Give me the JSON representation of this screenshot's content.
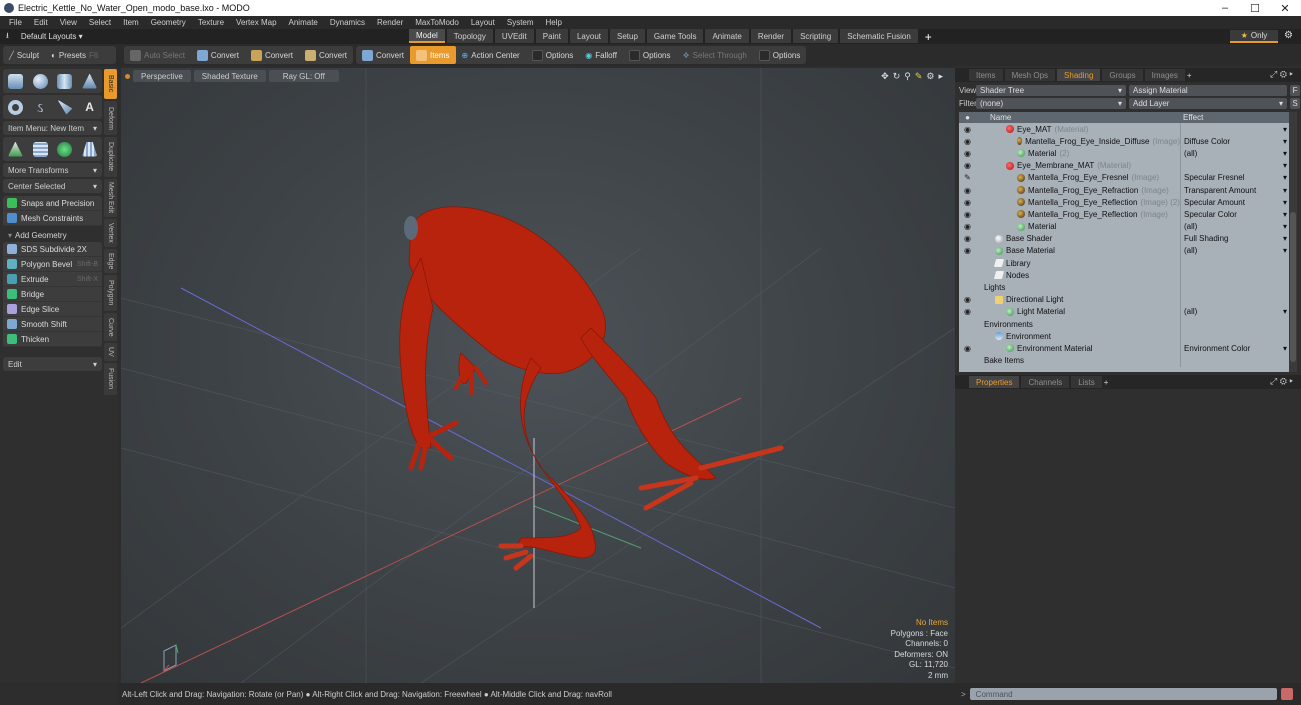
{
  "window": {
    "title": "Electric_Kettle_No_Water_Open_modo_base.lxo - MODO",
    "controls": {
      "minimize": "–",
      "maximize": "☐",
      "close": "✕"
    }
  },
  "menu": [
    "File",
    "Edit",
    "View",
    "Select",
    "Item",
    "Geometry",
    "Texture",
    "Vertex Map",
    "Animate",
    "Dynamics",
    "Render",
    "MaxToModo",
    "Layout",
    "System",
    "Help"
  ],
  "layoutbar": {
    "layouts_label": "Default Layouts ▾",
    "tabs": [
      "Model",
      "Topology",
      "UVEdit",
      "Paint",
      "Layout",
      "Setup",
      "Game Tools",
      "Animate",
      "Render",
      "Scripting",
      "Schematic Fusion"
    ],
    "active_tab": "Model",
    "add_tab": "+",
    "only_label": "Only"
  },
  "toolbar": {
    "sculpt": "Sculpt",
    "presets": "Presets",
    "presets_key": "F6",
    "auto_select": "Auto Select",
    "convert1": "Convert",
    "convert2": "Convert",
    "convert3": "Convert",
    "convert4": "Convert",
    "items": "Items",
    "action_center": "Action Center",
    "options1": "Options",
    "falloff": "Falloff",
    "options2": "Options",
    "select_through": "Select Through",
    "options3": "Options"
  },
  "leftpanel": {
    "item_menu": "Item Menu: New Item",
    "more_transforms": "More Transforms",
    "center_selected": "Center Selected",
    "snaps": "Snaps and Precision",
    "mesh_constraints": "Mesh Constraints",
    "add_geometry": "Add Geometry",
    "tools": [
      {
        "label": "SDS Subdivide 2X",
        "shortcut": ""
      },
      {
        "label": "Polygon Bevel",
        "shortcut": "Shift-B"
      },
      {
        "label": "Extrude",
        "shortcut": "Shift-X"
      },
      {
        "label": "Bridge",
        "shortcut": ""
      },
      {
        "label": "Edge Slice",
        "shortcut": ""
      },
      {
        "label": "Smooth Shift",
        "shortcut": ""
      },
      {
        "label": "Thicken",
        "shortcut": ""
      }
    ],
    "edit_dropdown": "Edit",
    "vtabs": [
      "Basic",
      "Deform",
      "Duplicate",
      "Mesh Edit",
      "Vertex",
      "Edge",
      "Polygon",
      "Curve",
      "UV",
      "Fusion"
    ],
    "active_vtab": "Basic"
  },
  "viewport": {
    "view": "Perspective",
    "shading": "Shaded Texture",
    "raygl": "Ray GL: Off",
    "info": {
      "selection": "No Items",
      "polygons": "Polygons : Face",
      "channels": "Channels: 0",
      "deformers": "Deformers: ON",
      "gl": "GL: 11,720",
      "unit": "2 mm"
    }
  },
  "statusbar": {
    "hint": "Alt-Left Click and Drag: Navigation: Rotate (or Pan) ● Alt-Right Click and Drag: Navigation: Freewheel ● Alt-Middle Click and Drag: navRoll"
  },
  "rightpanel": {
    "tabs": [
      "Items",
      "Mesh Ops",
      "Shading",
      "Groups",
      "Images"
    ],
    "active_tab": "Shading",
    "view_label": "View",
    "view_value": "Shader Tree",
    "assign_material": "Assign Material",
    "f_btn": "F",
    "filter_label": "Filter",
    "filter_value": "(none)",
    "add_layer": "Add Layer",
    "s_btn": "S",
    "col_name": "Name",
    "col_effect": "Effect",
    "rows": [
      {
        "indent": 2,
        "name": "Eye_MAT",
        "sub": "(Material)",
        "effect": "",
        "eye": true,
        "icon": "mat",
        "dd": true
      },
      {
        "indent": 3,
        "name": "Mantella_Frog_Eye_Inside_Diffuse",
        "sub": "(Image)",
        "effect": "Diffuse Color",
        "eye": true,
        "icon": "img",
        "dd": true
      },
      {
        "indent": 3,
        "name": "Material",
        "sub": "(2)",
        "effect": "(all)",
        "eye": true,
        "icon": "ball",
        "dd": true
      },
      {
        "indent": 2,
        "name": "Eye_Membrane_MAT",
        "sub": "(Material)",
        "effect": "",
        "eye": true,
        "icon": "mat",
        "dd": true
      },
      {
        "indent": 3,
        "name": "Mantella_Frog_Eye_Fresnel",
        "sub": "(Image)",
        "effect": "Specular Fresnel",
        "eye": "brush",
        "icon": "img",
        "dd": true
      },
      {
        "indent": 3,
        "name": "Mantella_Frog_Eye_Refraction",
        "sub": "(Image)",
        "effect": "Transparent Amount",
        "eye": true,
        "icon": "img",
        "dd": true
      },
      {
        "indent": 3,
        "name": "Mantella_Frog_Eye_Reflection",
        "sub": "(Image) (2)",
        "effect": "Specular Amount",
        "eye": true,
        "icon": "img",
        "dd": true
      },
      {
        "indent": 3,
        "name": "Mantella_Frog_Eye_Reflection",
        "sub": "(Image)",
        "effect": "Specular Color",
        "eye": true,
        "icon": "img",
        "dd": true
      },
      {
        "indent": 3,
        "name": "Material",
        "sub": "",
        "effect": "(all)",
        "eye": true,
        "icon": "ball",
        "dd": true
      },
      {
        "indent": 1,
        "name": "Base Shader",
        "sub": "",
        "effect": "Full Shading",
        "eye": true,
        "icon": "white",
        "dd": true
      },
      {
        "indent": 1,
        "name": "Base Material",
        "sub": "",
        "effect": "(all)",
        "eye": true,
        "icon": "ball",
        "dd": true
      },
      {
        "indent": 1,
        "name": "Library",
        "sub": "",
        "effect": "",
        "eye": false,
        "icon": "folder",
        "dd": false
      },
      {
        "indent": 1,
        "name": "Nodes",
        "sub": "",
        "effect": "",
        "eye": false,
        "icon": "folder",
        "dd": false
      },
      {
        "indent": 0,
        "name": "Lights",
        "sub": "",
        "effect": "",
        "eye": false,
        "icon": "none",
        "dd": false
      },
      {
        "indent": 1,
        "name": "Directional Light",
        "sub": "",
        "effect": "",
        "eye": true,
        "icon": "light",
        "dd": false
      },
      {
        "indent": 2,
        "name": "Light Material",
        "sub": "",
        "effect": "(all)",
        "eye": true,
        "icon": "ball",
        "dd": true
      },
      {
        "indent": 0,
        "name": "Environments",
        "sub": "",
        "effect": "",
        "eye": false,
        "icon": "none",
        "dd": false
      },
      {
        "indent": 1,
        "name": "Environment",
        "sub": "",
        "effect": "",
        "eye": false,
        "icon": "env",
        "dd": false
      },
      {
        "indent": 2,
        "name": "Environment Material",
        "sub": "",
        "effect": "Environment Color",
        "eye": true,
        "icon": "ball",
        "dd": true
      },
      {
        "indent": 0,
        "name": "Bake Items",
        "sub": "",
        "effect": "",
        "eye": false,
        "icon": "none",
        "dd": false
      }
    ],
    "props_tabs": [
      "Properties",
      "Channels",
      "Lists"
    ],
    "props_active": "Properties"
  },
  "command": {
    "placeholder": "Command"
  },
  "colors": {
    "accent": "#e99a2c",
    "frog": "#b8230e"
  }
}
